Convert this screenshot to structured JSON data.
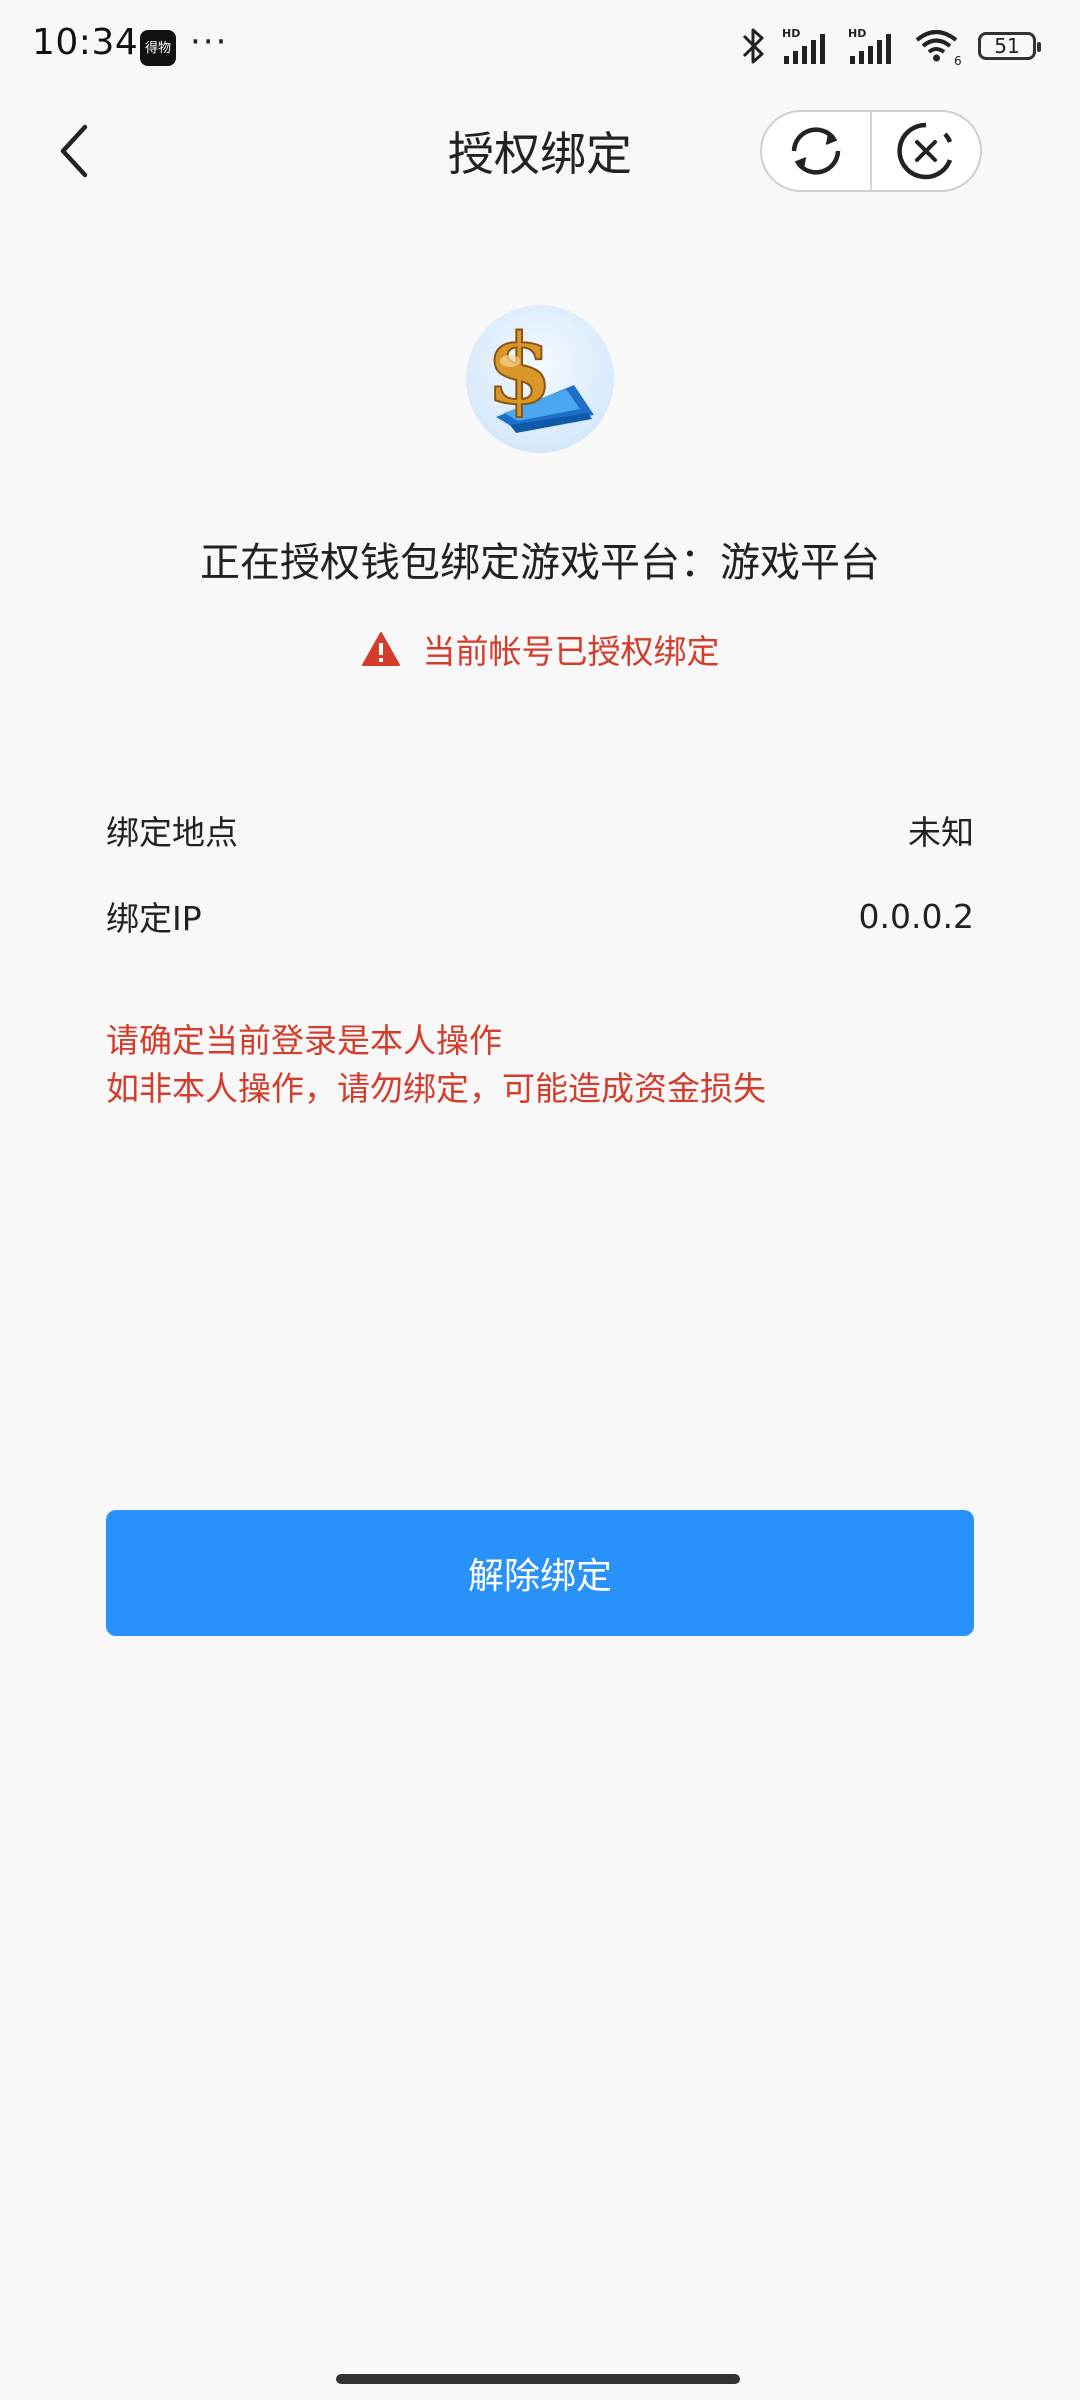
{
  "status_bar": {
    "time": "10:34",
    "app_icon_label": "得物",
    "more": "···",
    "hd1": "HD",
    "hd2": "HD",
    "wifi_sub": "6",
    "battery": "51"
  },
  "header": {
    "title": "授权绑定"
  },
  "auth": {
    "title": "正在授权钱包绑定游戏平台：游戏平台",
    "warning": "当前帐号已授权绑定"
  },
  "info": {
    "location_label": "绑定地点",
    "location_value": "未知",
    "ip_label": "绑定IP",
    "ip_value": "0.0.0.2"
  },
  "notice": {
    "line1": "请确定当前登录是本人操作",
    "line2": "如非本人操作，请勿绑定，可能造成资金损失"
  },
  "actions": {
    "unbind_label": "解除绑定"
  },
  "colors": {
    "accent": "#2891fa",
    "warning": "#d43c2c",
    "background": "#f8f8f8"
  },
  "icons": {
    "back": "chevron-left-icon",
    "refresh": "refresh-icon",
    "close": "close-circle-icon",
    "warning": "warning-triangle-icon",
    "bluetooth": "bluetooth-icon",
    "signal": "signal-icon",
    "wifi": "wifi-icon",
    "battery": "battery-icon"
  }
}
